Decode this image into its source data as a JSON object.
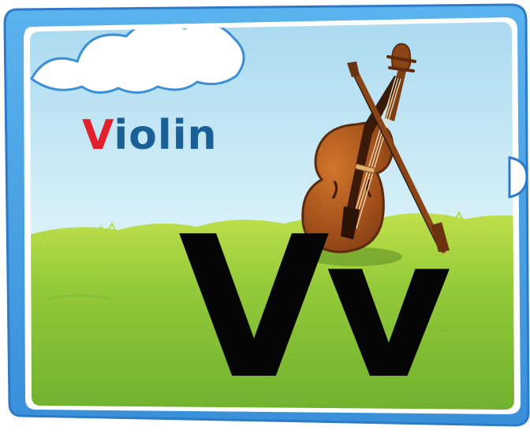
{
  "card": {
    "word_first_letter": "V",
    "word_rest": "iolin",
    "letter_upper": "V",
    "letter_lower": "v"
  },
  "colors": {
    "frame_blue": "#4aa3e6",
    "frame_dark": "#2c7bc8",
    "sky": "#c7e9f6",
    "grass": "#8cc63a",
    "word_red": "#e0202a",
    "word_blue": "#1a5f95",
    "letters": "#050505",
    "violin_body": "#a8541c"
  },
  "icons": {
    "illustration": "violin-with-bow-icon",
    "cloud": "cloud-icon"
  }
}
